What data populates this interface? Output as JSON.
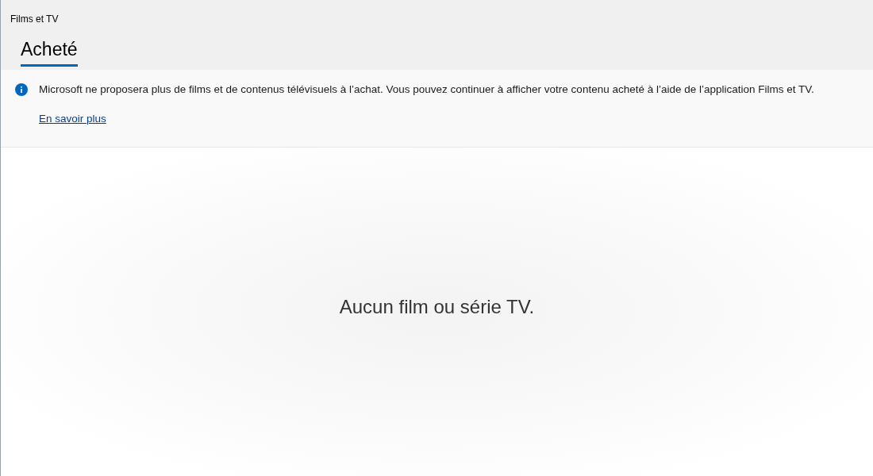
{
  "window": {
    "title": "Films et TV"
  },
  "tabs": [
    {
      "label": "Acheté",
      "selected": true
    }
  ],
  "info_bar": {
    "message": "Microsoft ne proposera plus de films et de contenus télévisuels à l’achat. Vous pouvez continuer à afficher votre contenu acheté à l’aide de l’application Films et TV.",
    "link": "En savoir plus"
  },
  "empty_state": "Aucun film ou série TV."
}
